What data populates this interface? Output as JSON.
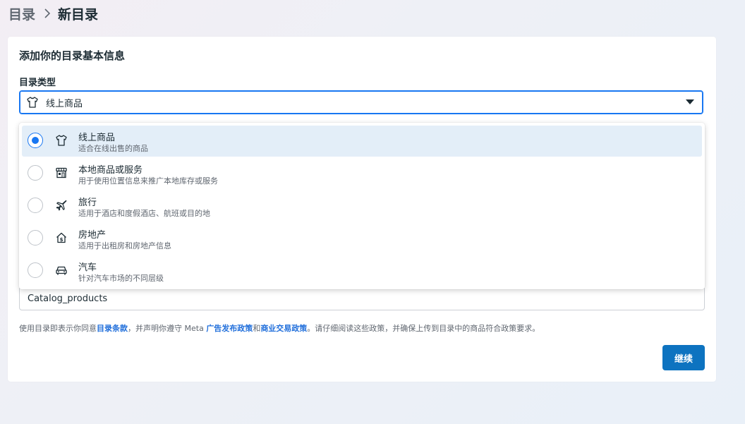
{
  "breadcrumb": {
    "root": "目录",
    "current": "新目录"
  },
  "card": {
    "title": "添加你的目录基本信息",
    "type_label": "目录类型",
    "selected_type": "线上商品",
    "name_value": "Catalog_products",
    "policy": {
      "part1": "使用目录即表示你同意",
      "link1": "目录条款",
      "part2": "，并声明你遵守 Meta ",
      "link2": "广告发布政策",
      "part3": "和",
      "link3": "商业交易政策",
      "part4": "。请仔细阅读这些政策，并确保上传到目录中的商品符合政策要求。"
    },
    "continue_label": "继续"
  },
  "dropdown": {
    "options": [
      {
        "title": "线上商品",
        "desc": "适合在线出售的商品",
        "icon": "tshirt-icon",
        "selected": true
      },
      {
        "title": "本地商品或服务",
        "desc": "用于使用位置信息来推广本地库存或服务",
        "icon": "store-icon",
        "selected": false
      },
      {
        "title": "旅行",
        "desc": "适用于酒店和度假酒店、航班或目的地",
        "icon": "airplane-icon",
        "selected": false
      },
      {
        "title": "房地产",
        "desc": "适用于出租房和房地产信息",
        "icon": "house-dollar-icon",
        "selected": false
      },
      {
        "title": "汽车",
        "desc": "针对汽车市场的不同层级",
        "icon": "car-icon",
        "selected": false
      }
    ]
  },
  "colors": {
    "accent": "#1877f2",
    "button": "#0d73c0",
    "selected_bg": "#e3eef8",
    "link": "#216fdb"
  }
}
